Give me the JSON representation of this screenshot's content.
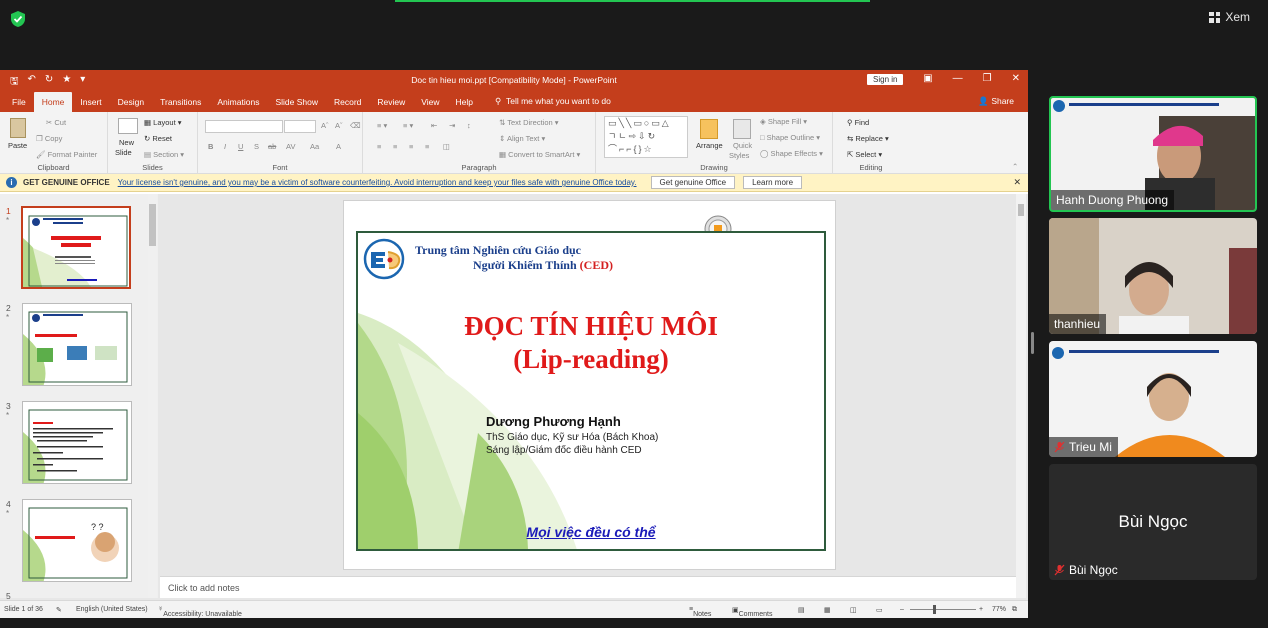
{
  "meeting": {
    "view_label": "Xem"
  },
  "ppt": {
    "window_title": "Doc tin hieu moi.ppt [Compatibility Mode]  -  PowerPoint",
    "sign_in": "Sign in",
    "tabs": [
      "File",
      "Home",
      "Insert",
      "Design",
      "Transitions",
      "Animations",
      "Slide Show",
      "Record",
      "Review",
      "View",
      "Help"
    ],
    "active_tab": "Home",
    "tell_me": "Tell me what you want to do",
    "share": "Share",
    "ribbon": {
      "clipboard": {
        "label": "Clipboard",
        "paste": "Paste",
        "cut": "Cut",
        "copy": "Copy",
        "format_painter": "Format Painter"
      },
      "slides": {
        "label": "Slides",
        "new_slide_1": "New",
        "new_slide_2": "Slide",
        "layout": "Layout",
        "reset": "Reset",
        "section": "Section"
      },
      "font": {
        "label": "Font"
      },
      "paragraph": {
        "label": "Paragraph",
        "text_direction": "Text Direction",
        "align_text": "Align Text",
        "convert_smartart": "Convert to SmartArt"
      },
      "drawing": {
        "label": "Drawing",
        "arrange": "Arrange",
        "quick_styles_1": "Quick",
        "quick_styles_2": "Styles",
        "shape_fill": "Shape Fill",
        "shape_outline": "Shape Outline",
        "shape_effects": "Shape Effects"
      },
      "editing": {
        "label": "Editing",
        "find": "Find",
        "replace": "Replace",
        "select": "Select"
      }
    },
    "infobar": {
      "title": "GET GENUINE OFFICE",
      "message": "Your license isn't genuine, and you may be a victim of software counterfeiting. Avoid interruption and keep your files safe with genuine Office today.",
      "btn_genuine": "Get genuine Office",
      "btn_learn": "Learn more"
    },
    "thumbnails": [
      {
        "num": "1",
        "star": "*"
      },
      {
        "num": "2",
        "star": "*"
      },
      {
        "num": "3",
        "star": "*"
      },
      {
        "num": "4",
        "star": "*"
      },
      {
        "num": "5",
        "star": ""
      }
    ],
    "slide": {
      "header_line1": "Trung tâm Nghiên cứu Giáo dục",
      "header_line2": "Người Khiếm Thính",
      "header_acronym": "(CED)",
      "title_line1": "ĐỌC TÍN HIỆU MÔI",
      "title_line2": "(Lip-reading)",
      "author": "Dương Phương Hạnh",
      "role_line1": "ThS Giáo dục, Kỹ sư Hóa (Bách Khoa)",
      "role_line2": "Sáng lập/Giám đốc điều hành CED",
      "motto": "Mọi việc đều có thể"
    },
    "notes_placeholder": "Click to add notes",
    "status": {
      "slide_count": "Slide 1 of 36",
      "language": "English (United States)",
      "accessibility": "Accessibility: Unavailable",
      "notes": "Notes",
      "comments": "Comments",
      "zoom": "77%"
    }
  },
  "participants": [
    {
      "name": "Hanh Duong Phuong",
      "muted": false,
      "active": true
    },
    {
      "name": "thanhieu",
      "muted": false,
      "active": false
    },
    {
      "name": "Trieu Mi",
      "muted": true,
      "active": false
    },
    {
      "name": "Bùi Ngọc",
      "muted": true,
      "active": false
    }
  ]
}
